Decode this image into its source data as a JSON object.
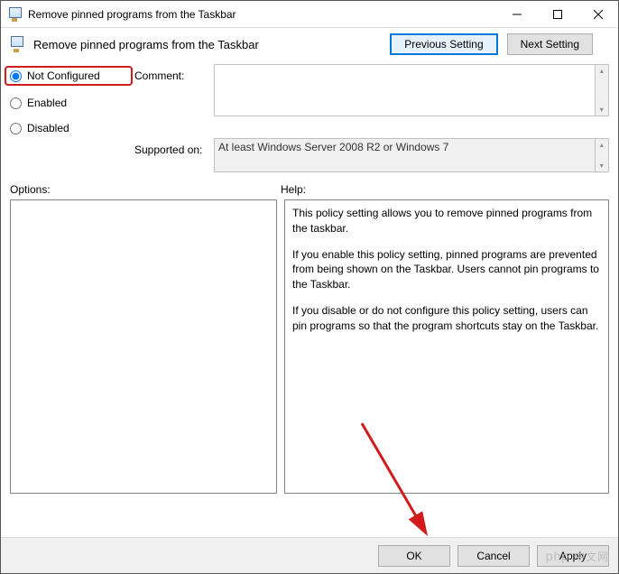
{
  "window": {
    "title": "Remove pinned programs from the Taskbar"
  },
  "header": {
    "title": "Remove pinned programs from the Taskbar",
    "prev_label": "Previous Setting",
    "next_label": "Next Setting"
  },
  "radios": {
    "not_configured": "Not Configured",
    "enabled": "Enabled",
    "disabled": "Disabled",
    "selected": "not_configured"
  },
  "labels": {
    "comment": "Comment:",
    "supported": "Supported on:",
    "options": "Options:",
    "help": "Help:"
  },
  "comment": "",
  "supported_on": "At least Windows Server 2008 R2 or Windows 7",
  "help": {
    "p1": "This policy setting allows you to remove pinned programs from the taskbar.",
    "p2": "If you enable this policy setting, pinned programs are prevented from being shown on the Taskbar. Users cannot pin programs to the Taskbar.",
    "p3": "If you disable or do not configure this policy setting, users can pin programs so that the program shortcuts stay on the Taskbar."
  },
  "footer": {
    "ok": "OK",
    "cancel": "Cancel",
    "apply": "Apply"
  },
  "watermark": {
    "brand": "php",
    "cn": "中文网"
  }
}
